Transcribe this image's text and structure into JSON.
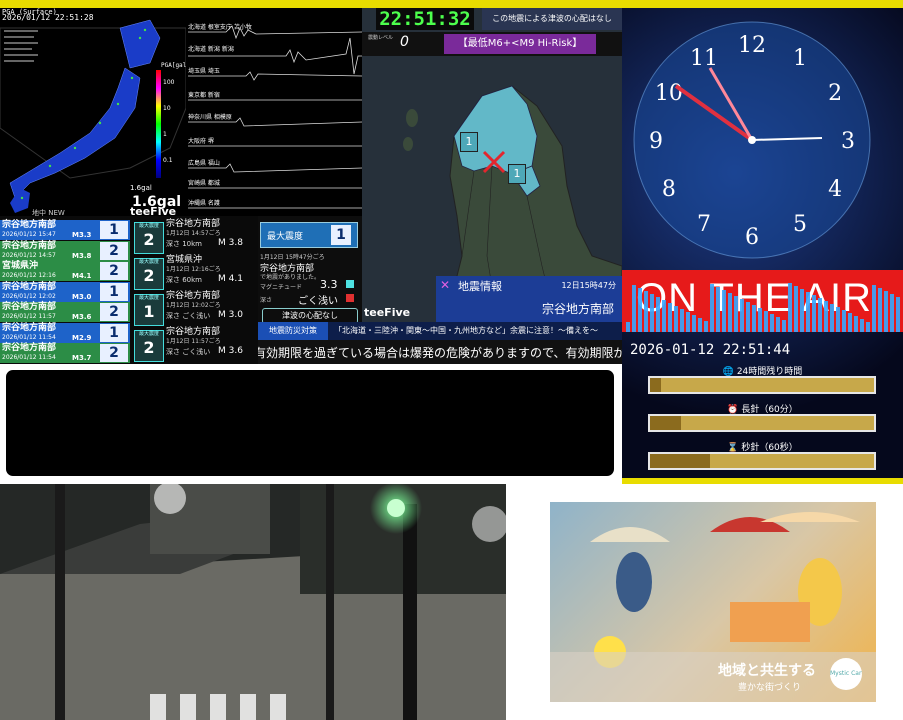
{
  "map_panel": {
    "header": "PGA (Surface)",
    "datetime": "2026/01/12 22:51:28",
    "legend_unit": "PGA[gal]",
    "legend_values": [
      "100",
      "10",
      "1",
      "0.1"
    ],
    "reading": "1.6gal",
    "reading_small": "1.6gal",
    "footer_left": "地中 NEW",
    "brand": "teeFive"
  },
  "wave_panel": {
    "stations": [
      "北海道 根室支庁 苫小牧",
      "北海道 新潟 新潟",
      "埼玉県 埼玉",
      "東京都 新宿",
      "神奈川県 相模原",
      "大阪府 堺",
      "広島県 福山",
      "宮崎県 都城",
      "沖縄県 名護"
    ]
  },
  "quake_list": [
    {
      "name": "宗谷地方南部",
      "time": "2026/01/12 15:47",
      "mag": "M3.3",
      "int": "1",
      "color": "#1e63c9"
    },
    {
      "name": "宗谷地方南部",
      "time": "2026/01/12 14:57",
      "mag": "M3.8",
      "int": "2",
      "color": "#2c8d46"
    },
    {
      "name": "宮城県沖",
      "time": "2026/01/12 12:16",
      "mag": "M4.1",
      "int": "2",
      "color": "#2c8d46"
    },
    {
      "name": "宗谷地方南部",
      "time": "2026/01/12 12:02",
      "mag": "M3.0",
      "int": "1",
      "color": "#1e63c9"
    },
    {
      "name": "宗谷地方南部",
      "time": "2026/01/12 11:57",
      "mag": "M3.6",
      "int": "2",
      "color": "#2c8d46"
    },
    {
      "name": "宗谷地方南部",
      "time": "2026/01/12 11:54",
      "mag": "M2.9",
      "int": "1",
      "color": "#1e63c9"
    },
    {
      "name": "宗谷地方南部",
      "time": "2026/01/12 11:54",
      "mag": "M3.7",
      "int": "2",
      "color": "#2c8d46"
    }
  ],
  "detail_cards": [
    {
      "badge": "最大震度",
      "int": "2",
      "name": "宗谷地方南部",
      "time": "1月12日 14:57ごろ",
      "depth": "深さ 10km",
      "mag": "M 3.8"
    },
    {
      "badge": "最大震度",
      "int": "2",
      "name": "宮城県沖",
      "time": "1月12日 12:16ごろ",
      "depth": "深さ 60km",
      "mag": "M 4.1"
    },
    {
      "badge": "最大震度",
      "int": "1",
      "name": "宗谷地方南部",
      "time": "1月12日 12:02ごろ",
      "depth": "深さ ごく浅い",
      "mag": "M 3.0"
    },
    {
      "badge": "最大震度",
      "int": "2",
      "name": "宗谷地方南部",
      "time": "1月12日 11:57ごろ",
      "depth": "深さ ごく浅い",
      "mag": "M 3.6"
    }
  ],
  "max_intensity": {
    "label": "最大震度",
    "value": "1",
    "date": "1月12日 15時47分ごろ",
    "area": "宗谷地方南部",
    "note": "で地震がありました。",
    "mag_label": "マグニチュード",
    "mag": "3.3",
    "depth_label": "深さ",
    "depth": "ごく浅い",
    "tsunami": "津波の心配なし"
  },
  "hokkaido_panel": {
    "clock": "22:51:32",
    "notice": "この地震による津波の心配はなし",
    "level_label": "震動レベル",
    "level": "0",
    "risk": "【最低M6+<M9 Hi-Risk】",
    "marker1": "1",
    "marker2": "1",
    "info_title": "地震情報",
    "info_time": "12日15時47分",
    "info_area": "宗谷地方南部",
    "brand": "teeFive"
  },
  "ticker": {
    "label": "地震防災対策",
    "headline": "「北海道・三陸沖・関東〜中国・九州地方など」余震に注意！〜備えを〜",
    "scroll": "有効期限を過ぎている場合は爆発の危険がありますので、有効期限が過ぎ"
  },
  "clock_panel": {
    "numbers": [
      "12",
      "1",
      "2",
      "3",
      "4",
      "5",
      "6",
      "7",
      "8",
      "9",
      "10",
      "11"
    ],
    "on_air": "ON THE AIR",
    "datetime": "2026-01-12 22:51:44",
    "bars": [
      {
        "icon": "earth-icon",
        "label": "24時間残り時間",
        "fill": 0.05
      },
      {
        "icon": "clock-icon",
        "label": "長針（60分）",
        "fill": 0.14
      },
      {
        "icon": "hourglass-icon",
        "label": "秒針（60秒）",
        "fill": 0.27
      }
    ]
  },
  "ad": {
    "tagline": "地域と共生する",
    "sub": "豊かな街づくり",
    "logo": "Mystic Cart"
  }
}
